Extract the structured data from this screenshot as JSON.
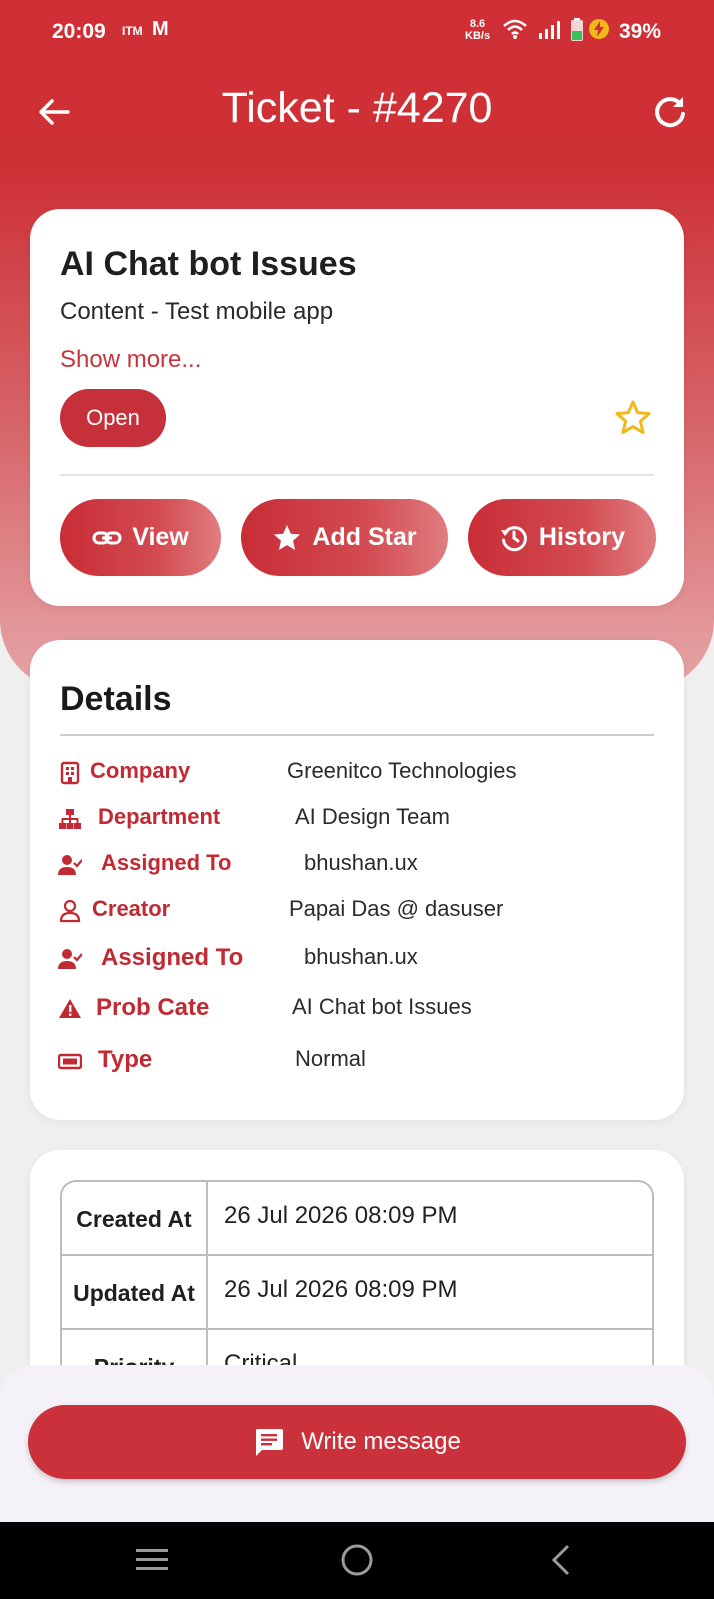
{
  "status_bar": {
    "time": "20:09",
    "carrier": "ITM",
    "gmail": "M",
    "net_speed_value": "8.6",
    "net_speed_unit": "KB/s",
    "battery_percent": "39%"
  },
  "app_bar": {
    "title": "Ticket - #4270"
  },
  "ticket": {
    "title": "AI Chat bot Issues",
    "subtitle": "Content - Test mobile app",
    "show_more": "Show more...",
    "status": "Open",
    "actions": {
      "view": "View",
      "add_star": "Add Star",
      "history": "History"
    }
  },
  "details": {
    "heading": "Details",
    "rows": [
      {
        "label": "Company",
        "value": "Greenitco Technologies",
        "icon": "building-icon"
      },
      {
        "label": "Department",
        "value": "AI Design Team",
        "icon": "org-chart-icon"
      },
      {
        "label": "Assigned To",
        "value": "bhushan.ux",
        "icon": "user-check-icon"
      },
      {
        "label": "Creator",
        "value": "Papai Das @ dasuser",
        "icon": "user-outline-icon"
      },
      {
        "label": "Assigned To",
        "value": "bhushan.ux",
        "icon": "user-check-icon"
      },
      {
        "label": "Prob Cate",
        "value": "AI Chat bot Issues",
        "icon": "warning-icon"
      },
      {
        "label": "Type",
        "value": "Normal",
        "icon": "ticket-icon"
      }
    ]
  },
  "meta": {
    "rows": [
      {
        "key": "Created At",
        "value": "26 Jul 2026 08:09 PM"
      },
      {
        "key": "Updated At",
        "value": "26 Jul 2026 08:09 PM"
      },
      {
        "key": "Priority",
        "value": "Critical"
      }
    ]
  },
  "compose": {
    "label": "Write message"
  },
  "colors": {
    "accent": "#cb313a",
    "label_red": "#c22a33",
    "star_gold": "#f2b718"
  }
}
